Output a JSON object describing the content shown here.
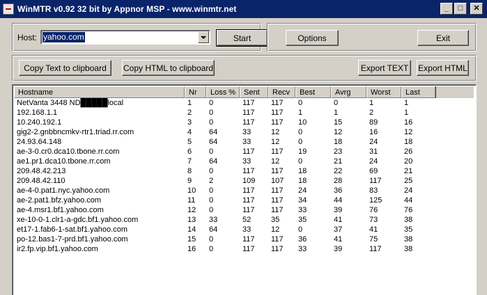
{
  "window": {
    "title": "WinMTR v0.92 32 bit by Appnor MSP - www.winmtr.net"
  },
  "titlebar_buttons": {
    "minimize": "_",
    "maximize": "□",
    "close": "✕"
  },
  "host": {
    "label": "Host:",
    "value": "yahoo.com"
  },
  "buttons": {
    "start": "Start",
    "options": "Options",
    "exit": "Exit",
    "copy_text": "Copy Text to clipboard",
    "copy_html": "Copy HTML to clipboard",
    "export_text": "Export TEXT",
    "export_html": "Export HTML"
  },
  "table": {
    "columns": [
      "Hostname",
      "Nr",
      "Loss %",
      "Sent",
      "Recv",
      "Best",
      "Avrg",
      "Worst",
      "Last"
    ],
    "rows": [
      [
        "NetVanta 3448 ND█████local",
        "1",
        "0",
        "117",
        "117",
        "0",
        "0",
        "1",
        "1"
      ],
      [
        "192.168.1.1",
        "2",
        "0",
        "117",
        "117",
        "1",
        "1",
        "2",
        "1"
      ],
      [
        "10.240.192.1",
        "3",
        "0",
        "117",
        "117",
        "10",
        "15",
        "89",
        "16"
      ],
      [
        "gig2-2.gnbbncmkv-rtr1.triad.rr.com",
        "4",
        "64",
        "33",
        "12",
        "0",
        "12",
        "16",
        "12"
      ],
      [
        "24.93.64.148",
        "5",
        "64",
        "33",
        "12",
        "0",
        "18",
        "24",
        "18"
      ],
      [
        "ae-3-0.cr0.dca10.tbone.rr.com",
        "6",
        "0",
        "117",
        "117",
        "19",
        "23",
        "31",
        "26"
      ],
      [
        "ae1.pr1.dca10.tbone.rr.com",
        "7",
        "64",
        "33",
        "12",
        "0",
        "21",
        "24",
        "20"
      ],
      [
        "209.48.42.213",
        "8",
        "0",
        "117",
        "117",
        "18",
        "22",
        "69",
        "21"
      ],
      [
        "209.48.42.110",
        "9",
        "2",
        "109",
        "107",
        "18",
        "28",
        "117",
        "25"
      ],
      [
        "ae-4-0.pat1.nyc.yahoo.com",
        "10",
        "0",
        "117",
        "117",
        "24",
        "36",
        "83",
        "24"
      ],
      [
        "ae-2.pat1.bfz.yahoo.com",
        "11",
        "0",
        "117",
        "117",
        "34",
        "44",
        "125",
        "44"
      ],
      [
        "ae-4.msr1.bf1.yahoo.com",
        "12",
        "0",
        "117",
        "117",
        "33",
        "39",
        "76",
        "76"
      ],
      [
        "xe-10-0-1.clr1-a-gdc.bf1.yahoo.com",
        "13",
        "33",
        "52",
        "35",
        "35",
        "41",
        "73",
        "38"
      ],
      [
        "et17-1.fab6-1-sat.bf1.yahoo.com",
        "14",
        "64",
        "33",
        "12",
        "0",
        "37",
        "41",
        "35"
      ],
      [
        "po-12.bas1-7-prd.bf1.yahoo.com",
        "15",
        "0",
        "117",
        "117",
        "36",
        "41",
        "75",
        "38"
      ],
      [
        "ir2.fp.vip.bf1.yahoo.com",
        "16",
        "0",
        "117",
        "117",
        "33",
        "39",
        "117",
        "38"
      ]
    ]
  }
}
